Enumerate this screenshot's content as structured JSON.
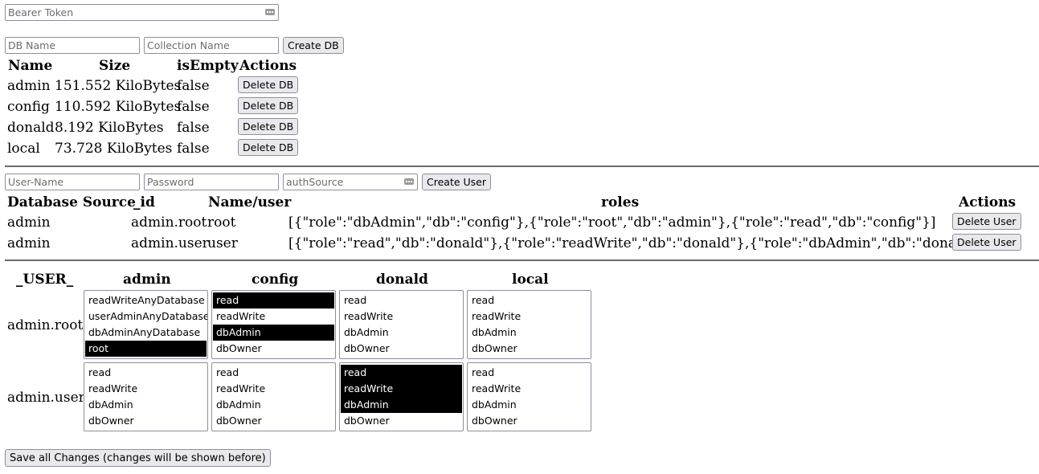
{
  "auth": {
    "bearer_placeholder": "Bearer Token"
  },
  "db_form": {
    "db_name_placeholder": "DB Name",
    "collection_placeholder": "Collection Name",
    "create_label": "Create DB"
  },
  "db_table": {
    "headers": [
      "Name",
      "Size",
      "isEmpty",
      "Actions"
    ],
    "rows": [
      {
        "name": "admin",
        "size": "151.552 KiloBytes",
        "isEmpty": "false",
        "action": "Delete DB"
      },
      {
        "name": "config",
        "size": "110.592 KiloBytes",
        "isEmpty": "false",
        "action": "Delete DB"
      },
      {
        "name": "donald",
        "size": "8.192 KiloBytes",
        "isEmpty": "false",
        "action": "Delete DB"
      },
      {
        "name": "local",
        "size": "73.728 KiloBytes",
        "isEmpty": "false",
        "action": "Delete DB"
      }
    ]
  },
  "user_form": {
    "username_placeholder": "User-Name",
    "password_placeholder": "Password",
    "authsource_placeholder": "authSource",
    "create_label": "Create User"
  },
  "user_table": {
    "headers": [
      "Database Source",
      "_id",
      "Name/user",
      "roles",
      "Actions"
    ],
    "rows": [
      {
        "source": "admin",
        "id": "admin.root",
        "user": "root",
        "roles": "[{\"role\":\"dbAdmin\",\"db\":\"config\"},{\"role\":\"root\",\"db\":\"admin\"},{\"role\":\"read\",\"db\":\"config\"}]",
        "action": "Delete User"
      },
      {
        "source": "admin",
        "id": "admin.user",
        "user": "user",
        "roles": "[{\"role\":\"read\",\"db\":\"donald\"},{\"role\":\"readWrite\",\"db\":\"donald\"},{\"role\":\"dbAdmin\",\"db\":\"donald\"}]",
        "action": "Delete User"
      }
    ]
  },
  "role_matrix": {
    "corner_header": "_USER_",
    "databases": [
      "admin",
      "config",
      "donald",
      "local"
    ],
    "users": [
      {
        "label": "admin.root",
        "cells": [
          {
            "options": [
              "readWriteAnyDatabase",
              "userAdminAnyDatabase",
              "dbAdminAnyDatabase",
              "root"
            ],
            "selected": [
              false,
              false,
              false,
              true
            ]
          },
          {
            "options": [
              "read",
              "readWrite",
              "dbAdmin",
              "dbOwner"
            ],
            "selected": [
              true,
              false,
              true,
              false
            ]
          },
          {
            "options": [
              "read",
              "readWrite",
              "dbAdmin",
              "dbOwner"
            ],
            "selected": [
              false,
              false,
              false,
              false
            ]
          },
          {
            "options": [
              "read",
              "readWrite",
              "dbAdmin",
              "dbOwner"
            ],
            "selected": [
              false,
              false,
              false,
              false
            ]
          }
        ]
      },
      {
        "label": "admin.user",
        "cells": [
          {
            "options": [
              "read",
              "readWrite",
              "dbAdmin",
              "dbOwner"
            ],
            "selected": [
              false,
              false,
              false,
              false
            ]
          },
          {
            "options": [
              "read",
              "readWrite",
              "dbAdmin",
              "dbOwner"
            ],
            "selected": [
              false,
              false,
              false,
              false
            ]
          },
          {
            "options": [
              "read",
              "readWrite",
              "dbAdmin",
              "dbOwner"
            ],
            "selected": [
              true,
              true,
              true,
              false
            ]
          },
          {
            "options": [
              "read",
              "readWrite",
              "dbAdmin",
              "dbOwner"
            ],
            "selected": [
              false,
              false,
              false,
              false
            ]
          }
        ]
      }
    ]
  },
  "save_label": "Save all Changes (changes will be shown before)"
}
